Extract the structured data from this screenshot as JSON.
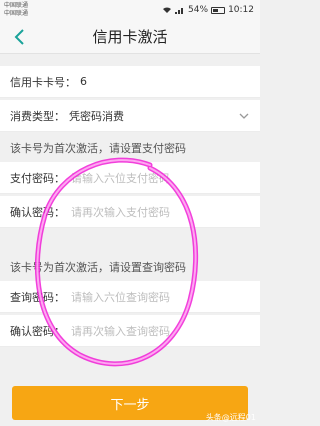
{
  "status_bar": {
    "carrier1": "中国联通",
    "carrier2": "中国联通",
    "battery": "54%",
    "time": "10:12",
    "battery_level": 0.54
  },
  "nav": {
    "title": "信用卡激活",
    "back_icon": "chevron-left-icon"
  },
  "card": {
    "number_label": "信用卡卡号：",
    "number_value": "6",
    "type_label": "消费类型：",
    "type_value": "凭密码消费"
  },
  "pay_section": {
    "header": "该卡号为首次激活，请设置支付密码",
    "password_label": "支付密码：",
    "password_placeholder": "请输入六位支付密码",
    "confirm_label": "确认密码：",
    "confirm_placeholder": "请再次输入支付密码"
  },
  "query_section": {
    "header": "该卡号为首次激活，请设置查询密码",
    "password_label": "查询密码：",
    "password_placeholder": "请输入六位查询密码",
    "confirm_label": "确认密码：",
    "confirm_placeholder": "请再次输入查询密码"
  },
  "next_button": "下一步",
  "watermark": "头条@远程01",
  "colors": {
    "accent": "#f7a613",
    "back_icon": "#1aa39a",
    "circle": "#f01fd6"
  }
}
